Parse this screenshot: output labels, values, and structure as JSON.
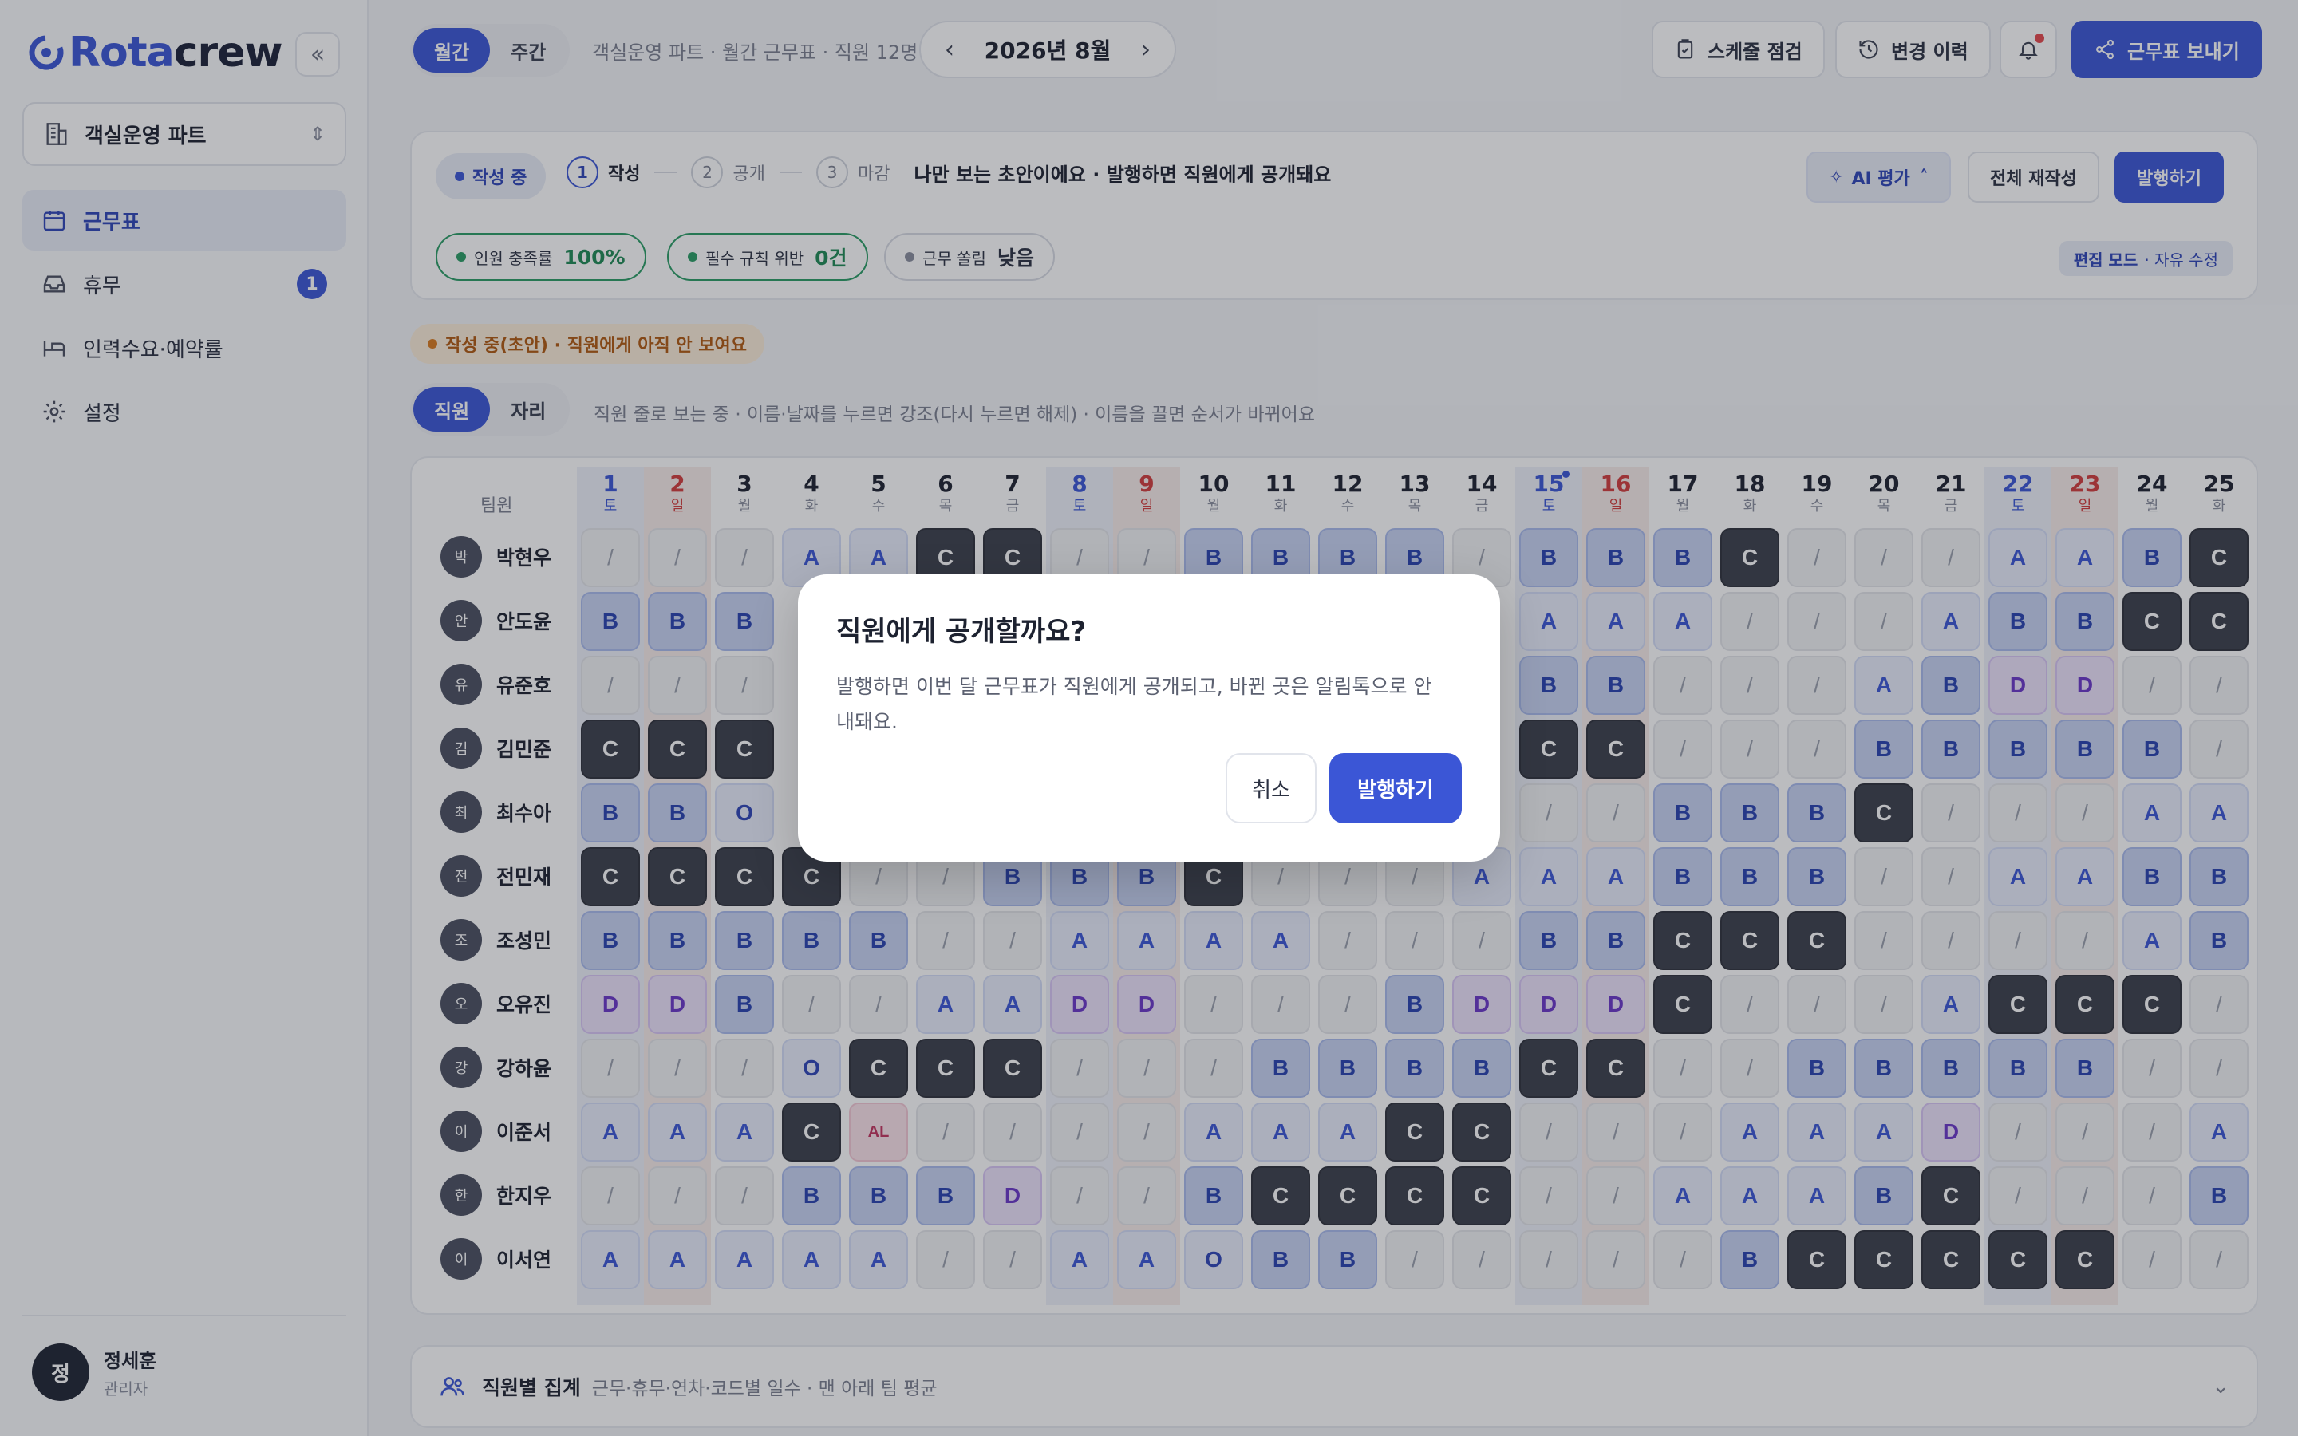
{
  "brand": {
    "logo_prefix": "Rota",
    "logo_suffix": "crew",
    "collapse_glyph": "«"
  },
  "sidebar": {
    "part_selector": "객실운영 파트",
    "items": [
      {
        "label": "근무표",
        "icon": "calendar-icon",
        "active": true
      },
      {
        "label": "휴무",
        "icon": "inbox-icon",
        "badge": "1"
      },
      {
        "label": "인력수요·예약률",
        "icon": "bed-icon"
      },
      {
        "label": "설정",
        "icon": "gear-icon"
      }
    ],
    "user": {
      "initial": "정",
      "name": "정세훈",
      "role": "관리자"
    }
  },
  "topbar": {
    "view_toggle": [
      "월간",
      "주간"
    ],
    "subtitle": "객실운영 파트 · 월간 근무표 · 직원 12명",
    "month": "2026년 8월",
    "prev_glyph": "‹",
    "next_glyph": "›",
    "check_button": "스케줄 점검",
    "history_button": "변경 이력",
    "send_button": "근무표 보내기"
  },
  "status_card": {
    "state_pill": "작성 중",
    "steps": [
      {
        "num": "1",
        "label": "작성"
      },
      {
        "num": "2",
        "label": "공개"
      },
      {
        "num": "3",
        "label": "마감"
      }
    ],
    "description": "나만 보는 초안이에요 · 발행하면 직원에게 공개돼요",
    "ai_button": "AI 평가",
    "regenerate_button": "전체 재작성",
    "publish_button": "발행하기",
    "metrics": [
      {
        "label": "인원 충족률",
        "value": "100%"
      },
      {
        "label": "필수 규칙 위반",
        "value": "0건"
      },
      {
        "label": "근무 쏠림",
        "value": "낮음"
      }
    ],
    "edit_mode": {
      "label": "편집 모드",
      "sub": "· 자유 수정"
    }
  },
  "draft_banner": "작성 중(초안) · 직원에게 아직 안 보여요",
  "view_tabs": [
    "직원",
    "자리"
  ],
  "view_hint": "직원 줄로 보는 중 · 이름·날짜를 누르면 강조(다시 누르면 해제) · 이름을 끌면 순서가 바뀌어요",
  "grid": {
    "team_header": "팀원",
    "days": [
      {
        "d": "1",
        "w": "토",
        "t": "sat"
      },
      {
        "d": "2",
        "w": "일",
        "t": "sun"
      },
      {
        "d": "3",
        "w": "월",
        "t": ""
      },
      {
        "d": "4",
        "w": "화",
        "t": ""
      },
      {
        "d": "5",
        "w": "수",
        "t": ""
      },
      {
        "d": "6",
        "w": "목",
        "t": ""
      },
      {
        "d": "7",
        "w": "금",
        "t": ""
      },
      {
        "d": "8",
        "w": "토",
        "t": "sat"
      },
      {
        "d": "9",
        "w": "일",
        "t": "sun"
      },
      {
        "d": "10",
        "w": "월",
        "t": ""
      },
      {
        "d": "11",
        "w": "화",
        "t": ""
      },
      {
        "d": "12",
        "w": "수",
        "t": ""
      },
      {
        "d": "13",
        "w": "목",
        "t": ""
      },
      {
        "d": "14",
        "w": "금",
        "t": ""
      },
      {
        "d": "15",
        "w": "토",
        "t": "sat",
        "holiday_dot": true
      },
      {
        "d": "16",
        "w": "일",
        "t": "sun"
      },
      {
        "d": "17",
        "w": "월",
        "t": ""
      },
      {
        "d": "18",
        "w": "화",
        "t": ""
      },
      {
        "d": "19",
        "w": "수",
        "t": ""
      },
      {
        "d": "20",
        "w": "목",
        "t": ""
      },
      {
        "d": "21",
        "w": "금",
        "t": ""
      },
      {
        "d": "22",
        "w": "토",
        "t": "sat"
      },
      {
        "d": "23",
        "w": "일",
        "t": "sun"
      },
      {
        "d": "24",
        "w": "월",
        "t": ""
      },
      {
        "d": "25",
        "w": "화",
        "t": ""
      }
    ],
    "employees": [
      {
        "initial": "박",
        "name": "박현우",
        "shifts": [
          "/",
          "/",
          "/",
          "A",
          "A",
          "C",
          "C",
          "/",
          "/",
          "B",
          "B",
          "B",
          "B",
          "/",
          "B",
          "B",
          "B",
          "C",
          "/",
          "/",
          "/",
          "A",
          "A",
          "B",
          "C"
        ]
      },
      {
        "initial": "안",
        "name": "안도윤",
        "shifts": [
          "B",
          "B",
          "B",
          "",
          "",
          "",
          "",
          "",
          "",
          "",
          "",
          "",
          "",
          "",
          "A",
          "A",
          "A",
          "/",
          "/",
          "/",
          "A",
          "B",
          "B",
          "C",
          "C"
        ]
      },
      {
        "initial": "유",
        "name": "유준호",
        "shifts": [
          "/",
          "/",
          "/",
          "",
          "",
          "",
          "",
          "",
          "",
          "",
          "",
          "",
          "",
          "",
          "B",
          "B",
          "/",
          "/",
          "/",
          "A",
          "B",
          "D",
          "D",
          "/",
          "/"
        ]
      },
      {
        "initial": "김",
        "name": "김민준",
        "shifts": [
          "C",
          "C",
          "C",
          "",
          "",
          "",
          "",
          "",
          "",
          "",
          "",
          "",
          "",
          "",
          "C",
          "C",
          "/",
          "/",
          "/",
          "B",
          "B",
          "B",
          "B",
          "B",
          "/"
        ]
      },
      {
        "initial": "최",
        "name": "최수아",
        "shifts": [
          "B",
          "B",
          "O",
          "",
          "",
          "",
          "",
          "",
          "",
          "",
          "",
          "",
          "",
          "",
          "/",
          "/",
          "B",
          "B",
          "B",
          "C",
          "/",
          "/",
          "/",
          "A",
          "A"
        ]
      },
      {
        "initial": "전",
        "name": "전민재",
        "shifts": [
          "C",
          "C",
          "C",
          "C",
          "/",
          "/",
          "B",
          "B",
          "B",
          "C",
          "/",
          "/",
          "/",
          "A",
          "A",
          "A",
          "B",
          "B",
          "B",
          "/",
          "/",
          "A",
          "A",
          "B",
          "B"
        ]
      },
      {
        "initial": "조",
        "name": "조성민",
        "shifts": [
          "B",
          "B",
          "B",
          "B",
          "B",
          "/",
          "/",
          "A",
          "A",
          "A",
          "A",
          "/",
          "/",
          "/",
          "B",
          "B",
          "C",
          "C",
          "C",
          "/",
          "/",
          "/",
          "/",
          "A",
          "B"
        ]
      },
      {
        "initial": "오",
        "name": "오유진",
        "shifts": [
          "D",
          "D",
          "B",
          "/",
          "/",
          "A",
          "A",
          "D",
          "D",
          "/",
          "/",
          "/",
          "B",
          "D",
          "D",
          "D",
          "C",
          "/",
          "/",
          "/",
          "A",
          "C",
          "C",
          "C",
          "/"
        ]
      },
      {
        "initial": "강",
        "name": "강하윤",
        "shifts": [
          "/",
          "/",
          "/",
          "O",
          "C",
          "C",
          "C",
          "/",
          "/",
          "/",
          "B",
          "B",
          "B",
          "B",
          "C",
          "C",
          "/",
          "/",
          "B",
          "B",
          "B",
          "B",
          "B",
          "/",
          "/"
        ]
      },
      {
        "initial": "이",
        "name": "이준서",
        "shifts": [
          "A",
          "A",
          "A",
          "C",
          "AL",
          "/",
          "/",
          "/",
          "/",
          "A",
          "A",
          "A",
          "C",
          "C",
          "/",
          "/",
          "/",
          "A",
          "A",
          "A",
          "D",
          "/",
          "/",
          "/",
          "A"
        ]
      },
      {
        "initial": "한",
        "name": "한지우",
        "shifts": [
          "/",
          "/",
          "/",
          "B",
          "B",
          "B",
          "D",
          "/",
          "/",
          "B",
          "C",
          "C",
          "C",
          "C",
          "/",
          "/",
          "A",
          "A",
          "A",
          "B",
          "C",
          "/",
          "/",
          "/",
          "B"
        ]
      },
      {
        "initial": "이",
        "name": "이서연",
        "shifts": [
          "A",
          "A",
          "A",
          "A",
          "A",
          "/",
          "/",
          "A",
          "A",
          "O",
          "B",
          "B",
          "/",
          "/",
          "/",
          "/",
          "/",
          "B",
          "C",
          "C",
          "C",
          "C",
          "C",
          "/",
          "/"
        ]
      }
    ]
  },
  "summary": {
    "title": "직원별 집계",
    "subtitle": "근무·휴무·연차·코드별 일수 · 맨 아래 팀 평균",
    "chevron": "⌄"
  },
  "modal": {
    "title": "직원에게 공개할까요?",
    "body": "발행하면 이번 달 근무표가 직원에게 공개되고, 바뀐 곳은 알림톡으로 안내돼요.",
    "cancel": "취소",
    "confirm": "발행하기"
  },
  "colors": {
    "accent": "#3b56d6",
    "success": "#1f8a55",
    "warning": "#b05a10",
    "danger": "#d33d3d"
  }
}
